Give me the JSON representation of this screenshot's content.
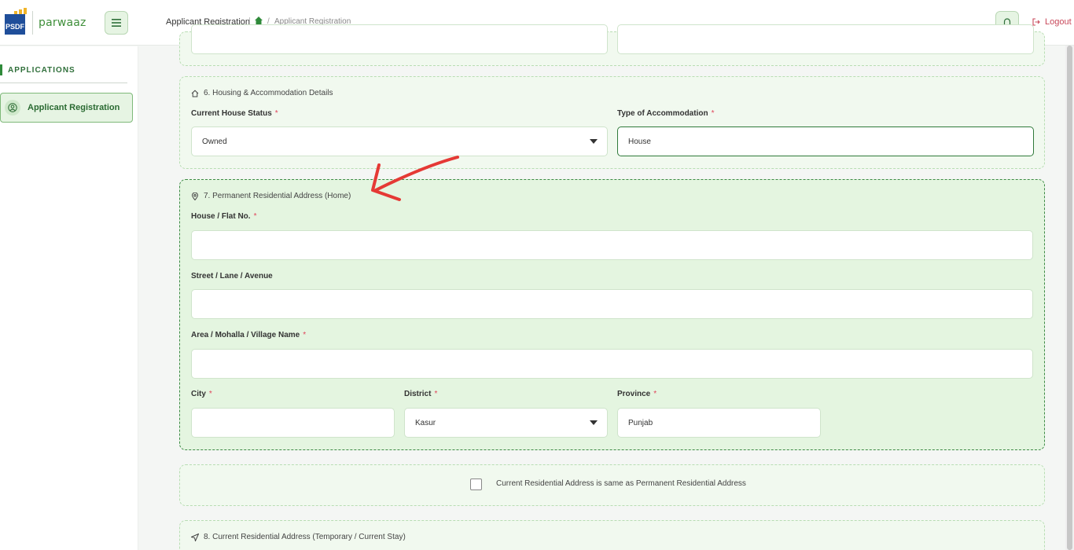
{
  "header": {
    "logo_text": "PSDF",
    "brand": "parwaaz",
    "breadcrumb_title": "Applicant Registration",
    "breadcrumb_current": "Applicant Registration",
    "logout_label": "Logout"
  },
  "sidebar": {
    "heading": "APPLICATIONS",
    "items": [
      {
        "label": "Applicant Registration"
      }
    ]
  },
  "sections": {
    "housing": {
      "title": "6. Housing & Accommodation Details",
      "house_status_label": "Current House Status",
      "house_status_value": "Owned",
      "accommodation_label": "Type of Accommodation",
      "accommodation_value": "House"
    },
    "permanent": {
      "title": "7. Permanent Residential Address (Home)",
      "house_label": "House / Flat No.",
      "street_label": "Street / Lane / Avenue",
      "area_label": "Area / Mohalla / Village Name",
      "city_label": "City",
      "district_label": "District",
      "district_value": "Kasur",
      "province_label": "Province",
      "province_value": "Punjab"
    },
    "same_address": {
      "label": "Current Residential Address is same as Permanent Residential Address"
    },
    "current": {
      "title": "8. Current Residential Address (Temporary / Current Stay)"
    }
  },
  "required_marker": "*",
  "colors": {
    "accent": "#2f8a3a",
    "section_bg": "#e4f5e0",
    "required": "#e0445a",
    "annotation_arrow": "#e53935"
  }
}
